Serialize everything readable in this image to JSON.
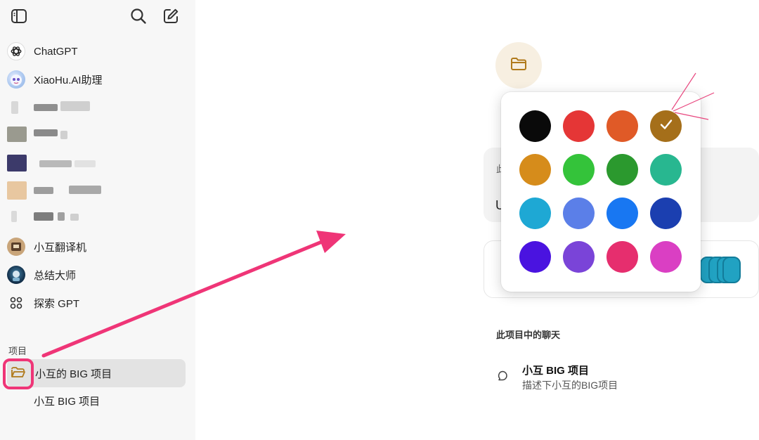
{
  "sidebar": {
    "items": [
      {
        "label": "ChatGPT"
      },
      {
        "label": "XiaoHu.AI助理"
      },
      {
        "label": "小互翻译机"
      },
      {
        "label": "总结大师"
      },
      {
        "label": "探索 GPT"
      }
    ],
    "section_label": "项目",
    "project": {
      "label": "小互的 BIG 项目"
    },
    "sub_chat": {
      "label": "小互 BIG 项目"
    }
  },
  "main": {
    "chats_heading": "此项目中的聊天",
    "chat": {
      "title": "小互 BIG 项目",
      "desc": "描述下小互的BIG项目"
    },
    "bg_chars": {
      "c1": "此",
      "c2": "U"
    }
  },
  "picker": {
    "colors": [
      "#0a0a0a",
      "#e53636",
      "#e05a27",
      "#a56f1a",
      "#d68c1b",
      "#34c33a",
      "#2b992e",
      "#28b790",
      "#1ea8d4",
      "#5b7fe8",
      "#1877f2",
      "#1b3fb0",
      "#4a13e0",
      "#7a44d8",
      "#e62e6e",
      "#da3fc3"
    ],
    "selected_index": 3
  },
  "theme": {
    "accent": "#ef3577",
    "folder": "#b07a1c"
  }
}
